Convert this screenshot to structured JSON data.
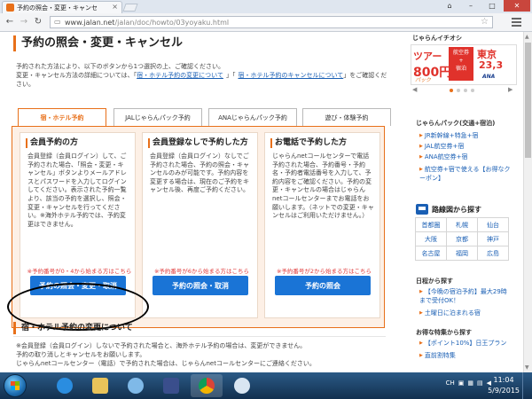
{
  "browser": {
    "tab_title": "予約の照会・変更・キャンセ",
    "tab_close": "×",
    "url_host": "www.jalan.net",
    "url_path": "/jalan/doc/howto/03yoyaku.html",
    "window_user": "⌂"
  },
  "page": {
    "title": "予約の照会・変更・キャンセル",
    "intro_line1": "予約された方法により、以下のボタンから1つ選択の上、ご確認ください。",
    "intro_line2_a": "変更・キャンセル方法の詳細については、「",
    "intro_link1": "宿・ホテル予約の変更について",
    "intro_link2": "宿・ホテル予約のキャンセルについて",
    "intro_line2_b": "」をご確認ください。",
    "tabs": [
      {
        "label": "宿・ホテル予約"
      },
      {
        "label": "JALじゃらんパック予約"
      },
      {
        "label": "ANAじゃらんパック予約"
      },
      {
        "label": "遊び・体験予約"
      }
    ],
    "columns": [
      {
        "heading": "会員予約の方",
        "body": "会員登録（会員ログイン）して、ご予約された場合、「照会・変更・キャンセル」ボタンよりメールアドレスとパスワードを入力してログインしてください。表示された予約一覧より、該当の予約を選択し、照会・変更・キャンセルを行ってください。※海外ホテル予約では、予約変更はできません。",
        "note": "※予約番号が0・4から始まる方はこちら",
        "button": "予約の照会・変更・取消"
      },
      {
        "heading": "会員登録なしで予約した方",
        "body": "会員登録（会員ログイン）なしでご予約された場合、予約の照会・キャンセルのみが可能です。予約内容を変更する場合は、現在のご予約をキャンセル後、再度ご予約ください。",
        "note": "※予約番号が6から始まる方はこちら",
        "button": "予約の照会・取消"
      },
      {
        "heading": "お電話で予約した方",
        "body": "じゃらんnetコールセンターで電話予約された場合、予約番号・予約名・予約者電話番号を入力して、予約内容をご確認ください。予約の変更・キャンセルの場合はじゃらんnetコールセンターまでお電話をお願いします。（ネットでの変更・キャンセルはご利用いただけません。）",
        "note": "※予約番号が2から始まる方はこちら",
        "button": "予約の照会"
      }
    ],
    "section2_title": "宿・ホテル予約の変更について",
    "section2_line1": "※会員登録（会員ログイン）しないで予約された場合と、海外ホテル予約の場合は、変更ができません。",
    "section2_line2": "予約の取り消しとキャンセルをお願いします。",
    "section2_line3": "じゃらんnetコールセンター（電話）で予約された場合は、じゃらんnetコールセンターにご連絡ください。"
  },
  "sidebar": {
    "heading": "じゃらんイチオシ",
    "ad": {
      "left_top": "ツアー",
      "left_price": "800円",
      "left_brand": "パック",
      "mid_line1": "航空券",
      "mid_line2": "+",
      "mid_line3": "宿泊",
      "right_top": "東京",
      "right_price": "23,3",
      "right_brand": "ANA"
    },
    "pack_title": "じゃらんパック(交通+宿泊)",
    "pack_links": [
      "JR新幹線+特急+宿",
      "JAL航空券+宿",
      "ANA航空券+宿",
      "航空券+宿で使える【お得なクーポン】"
    ],
    "map_title": "路線図から探す",
    "cities": [
      "首都圏",
      "札幌",
      "仙台",
      "大阪",
      "京都",
      "神戸",
      "名古屋",
      "福岡",
      "広島"
    ],
    "ring_title": "日程から探す",
    "ring_links": [
      "【今晩の宿泊予約】最大29時まで受付OK！",
      "土曜日に泊まれる宿"
    ],
    "deals_title": "お得な特集から探す",
    "deals_links": [
      "【ポイント10%】日王プラン",
      "直前割特集"
    ]
  },
  "taskbar": {
    "lang": "CH",
    "time": "11:04",
    "date": "5/9/2015"
  },
  "colors": {
    "accent": "#e8701a",
    "button": "#1a74d6",
    "link": "#1a5fb4",
    "note": "#e03a3a"
  }
}
